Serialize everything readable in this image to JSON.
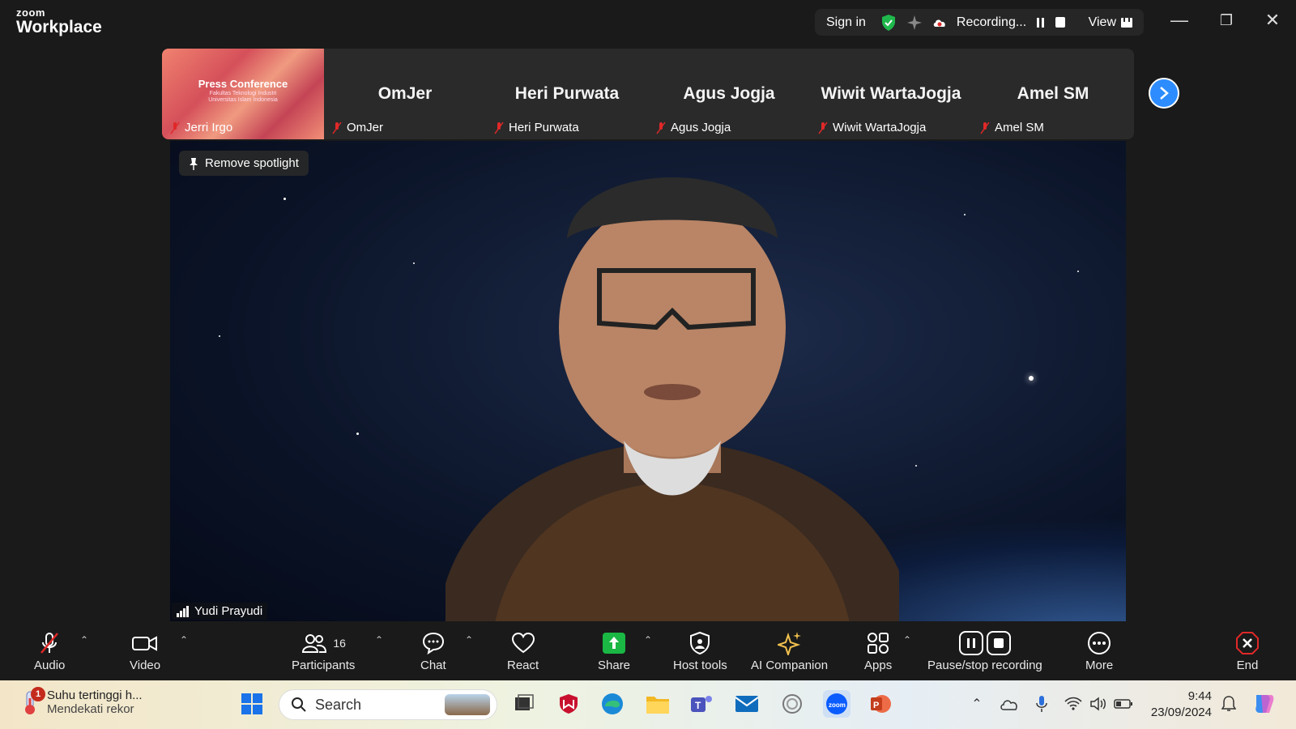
{
  "app": {
    "logo_top": "zoom",
    "logo_bottom": "Workplace"
  },
  "status": {
    "signin": "Sign in",
    "recording": "Recording...",
    "view": "View"
  },
  "thumbnails": [
    {
      "big": "",
      "name": "Jerri Irgo",
      "slide_title": "Press Conference",
      "slide_sub": "Fakultas Teknologi Industri\nUniversitas Islam Indonesia"
    },
    {
      "big": "OmJer",
      "name": "OmJer"
    },
    {
      "big": "Heri Purwata",
      "name": "Heri Purwata"
    },
    {
      "big": "Agus Jogja",
      "name": "Agus Jogja"
    },
    {
      "big": "Wiwit WartaJogja",
      "name": "Wiwit WartaJogja"
    },
    {
      "big": "Amel SM",
      "name": "Amel SM"
    }
  ],
  "video": {
    "spotlight_label": "Remove spotlight",
    "speaker": "Yudi Prayudi"
  },
  "toolbar": {
    "audio": "Audio",
    "video": "Video",
    "participants": "Participants",
    "participants_count": "16",
    "chat": "Chat",
    "react": "React",
    "share": "Share",
    "host_tools": "Host tools",
    "ai": "AI Companion",
    "apps": "Apps",
    "recording": "Pause/stop recording",
    "more": "More",
    "end": "End"
  },
  "taskbar": {
    "weather_title": "Suhu tertinggi h...",
    "weather_sub": "Mendekati rekor",
    "weather_badge": "1",
    "search": "Search",
    "time": "9:44",
    "date": "23/09/2024"
  },
  "colors": {
    "accent": "#2d8cff",
    "share": "#1ab744",
    "end": "#e02828",
    "mute": "#e02828"
  }
}
